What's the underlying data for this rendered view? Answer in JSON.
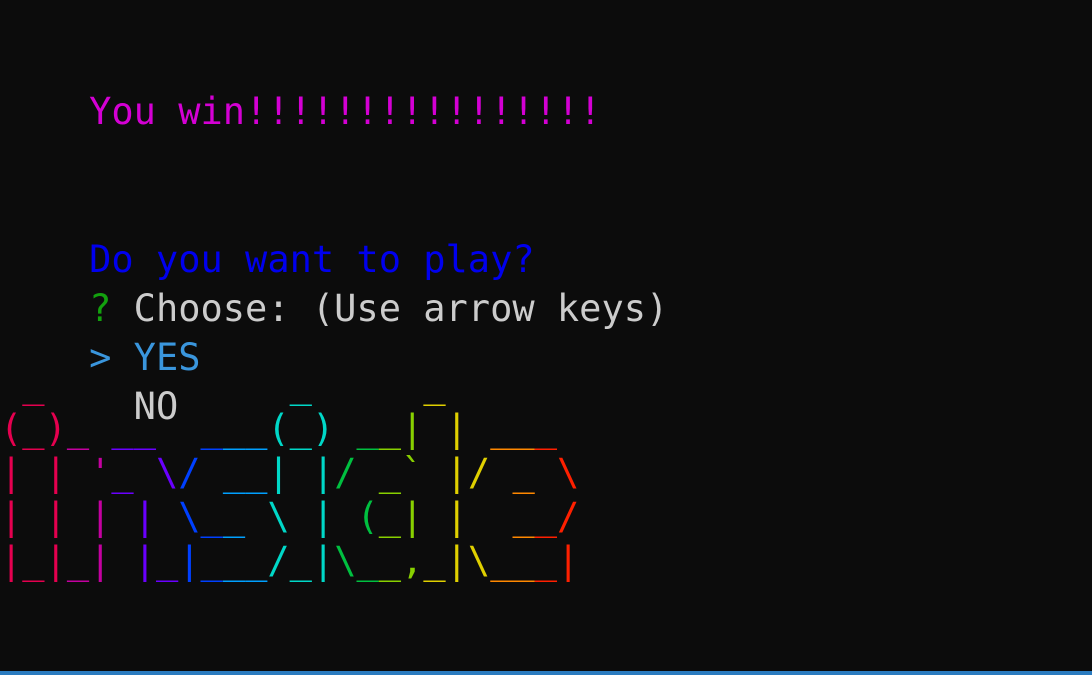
{
  "terminal": {
    "win_message": "You win!!!!!!!!!!!!!!!!",
    "win_color": "#d400d4",
    "question": "Do you want to play?",
    "question_color": "#0000ee",
    "prompt_symbol": "?",
    "prompt_symbol_color": "#13a10e",
    "prompt_text": " Choose: (Use arrow keys)",
    "options": [
      {
        "pointer": "> ",
        "label": "YES",
        "selected": true,
        "color": "#3a96dd"
      },
      {
        "pointer": "  ",
        "label": "NO",
        "selected": false,
        "color": "#cccccc"
      }
    ],
    "ascii_art_logo": "inside",
    "ascii_art_lines": [
      " _           _     _      ",
      "(_)_ __  ___(_) __| | ___ ",
      "| | '_ \\/ __| |/ _` |/ _ \\",
      "| | | | \\__ \\ | (_| |  __/",
      "|_|_| |_|___/_|\\__,_|\\___|"
    ],
    "rainbow_colors": [
      "#e5004f",
      "#c400a0",
      "#6a00ff",
      "#0040ff",
      "#00a0ff",
      "#00d8c8",
      "#00c040",
      "#88d000",
      "#e0d000",
      "#ff8800",
      "#ff2000"
    ]
  }
}
